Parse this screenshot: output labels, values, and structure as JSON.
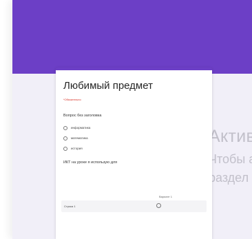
{
  "form": {
    "title": "Любимый предмет",
    "required_note": "*Обязательно",
    "question1": {
      "title": "Вопрос без заголовка",
      "options": [
        "информатика",
        "математика",
        "история"
      ]
    },
    "question2": {
      "title": "ИКТ на уроке я использую для",
      "column_header": "Вариант 1",
      "row_label": "Строка 1"
    }
  },
  "activation_watermark": {
    "line1": "Актива",
    "line2": "Чтобы ак",
    "line3": "раздел \"П"
  },
  "colors": {
    "accent": "#6c3fc6",
    "background": "#f1eff8",
    "watermark": "#bdbcc6"
  }
}
